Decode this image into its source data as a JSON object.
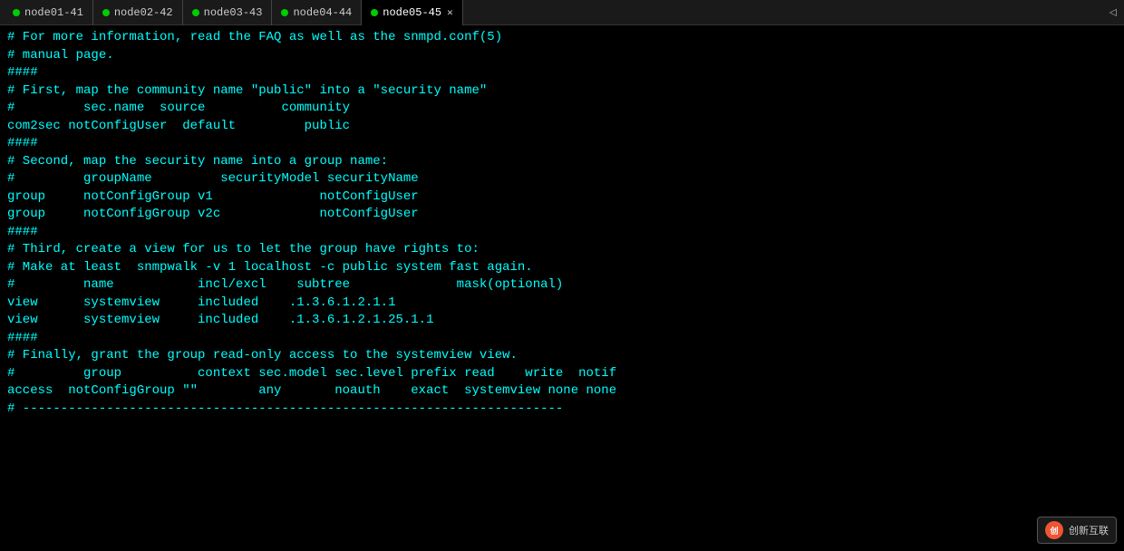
{
  "tabs": [
    {
      "id": "node01-41",
      "label": "node01-41",
      "active": false,
      "closeable": false
    },
    {
      "id": "node02-42",
      "label": "node02-42",
      "active": false,
      "closeable": false
    },
    {
      "id": "node03-43",
      "label": "node03-43",
      "active": false,
      "closeable": false
    },
    {
      "id": "node04-44",
      "label": "node04-44",
      "active": false,
      "closeable": false
    },
    {
      "id": "node05-45",
      "label": "node05-45",
      "active": true,
      "closeable": true
    }
  ],
  "scroll_indicator": "◁",
  "code_lines": [
    "# For more information, read the FAQ as well as the snmpd.conf(5)",
    "# manual page.",
    "",
    "####",
    "# First, map the community name \"public\" into a \"security name\"",
    "",
    "#         sec.name  source          community",
    "com2sec notConfigUser  default         public",
    "",
    "####",
    "# Second, map the security name into a group name:",
    "",
    "#         groupName         securityModel securityName",
    "group     notConfigGroup v1              notConfigUser",
    "group     notConfigGroup v2c             notConfigUser",
    "",
    "####",
    "# Third, create a view for us to let the group have rights to:",
    "",
    "# Make at least  snmpwalk -v 1 localhost -c public system fast again.",
    "#         name           incl/excl    subtree              mask(optional)",
    "view      systemview     included    .1.3.6.1.2.1.1",
    "view      systemview     included    .1.3.6.1.2.1.25.1.1",
    "",
    "####",
    "# Finally, grant the group read-only access to the systemview view.",
    "",
    "#         group          context sec.model sec.level prefix read    write  notif",
    "access  notConfigGroup \"\"        any       noauth    exact  systemview none none",
    "",
    "# -----------------------------------------------------------------------"
  ],
  "watermark": {
    "icon_text": "创",
    "text": "创新互联"
  }
}
